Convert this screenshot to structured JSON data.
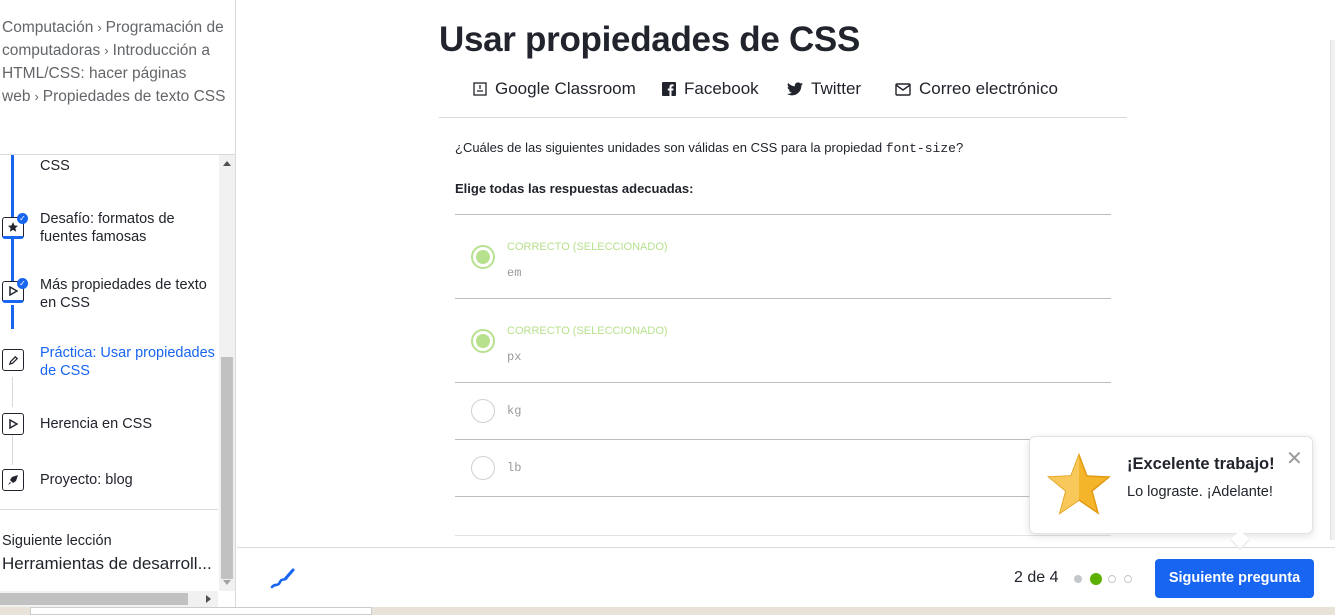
{
  "breadcrumb": {
    "items": [
      "Computación",
      "Programación de computadoras",
      "Introducción a HTML/CSS: hacer páginas web",
      "Propiedades de texto CSS"
    ],
    "separator": "›"
  },
  "sidebar": {
    "partial_item_label": "CSS",
    "lessons": [
      {
        "label": "Desafío: formatos de fuentes famosas",
        "icon": "star-icon",
        "completed": true
      },
      {
        "label": "Más propiedades de texto en CSS",
        "icon": "play-icon",
        "completed": true
      },
      {
        "label": "Práctica: Usar propiedades de CSS",
        "icon": "pencil-icon",
        "completed": false,
        "active": true
      },
      {
        "label": "Herencia en CSS",
        "icon": "play-icon",
        "completed": false
      },
      {
        "label": "Proyecto: blog",
        "icon": "rocket-icon",
        "completed": false
      }
    ],
    "next_lesson_label": "Siguiente lección",
    "next_lesson_title": "Herramientas de desarroll..."
  },
  "main": {
    "title": "Usar propiedades de CSS",
    "share": [
      "Google Classroom",
      "Facebook",
      "Twitter",
      "Correo electrónico"
    ],
    "question_prefix": "¿Cuáles de las siguientes unidades son válidas en CSS para la propiedad ",
    "question_code": "font-size",
    "question_suffix": "?",
    "instruction": "Elige todas las respuestas adecuadas:",
    "choices": [
      {
        "status": "CORRECTO (SELECCIONADO)",
        "value": "em"
      },
      {
        "status": "CORRECTO (SELECCIONADO)",
        "value": "px"
      },
      {
        "status": "",
        "value": "kg"
      },
      {
        "status": "",
        "value": "lb"
      }
    ]
  },
  "footer": {
    "progress_text": "2 de 4",
    "current": 2,
    "total": 4,
    "next_button": "Siguiente pregunta"
  },
  "toast": {
    "title": "¡Excelente trabajo!",
    "body": "Lo lograste. ¡Adelante!",
    "close": "✕"
  },
  "colors": {
    "accent": "#1865f2",
    "correct": "#b7e18d",
    "progress_current": "#5cb000",
    "star": "#f5b52a"
  }
}
